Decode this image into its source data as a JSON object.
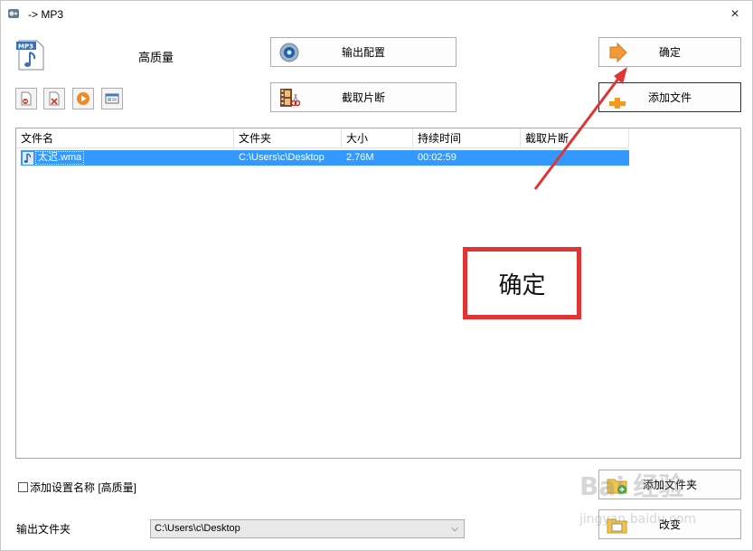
{
  "window": {
    "title": "-> MP3",
    "close_glyph": "×"
  },
  "header": {
    "quality_label": "高质量"
  },
  "toolbar": {
    "icons": [
      "remove-file-icon",
      "clear-list-icon",
      "play-icon",
      "media-info-icon"
    ]
  },
  "buttons": {
    "output_config": "输出配置",
    "clip": "截取片断",
    "ok": "确定",
    "add_file": "添加文件",
    "add_folder": "添加文件夹",
    "change": "改变"
  },
  "table": {
    "columns": [
      "文件名",
      "文件夹",
      "大小",
      "持续时间",
      "截取片断"
    ],
    "rows": [
      {
        "name": "太迟.wma",
        "folder": "C:\\Users\\c\\Desktop",
        "size": "2.76M",
        "duration": "00:02:59",
        "clip": ""
      }
    ]
  },
  "annotation": {
    "text": "确定",
    "color": "#e03535"
  },
  "bottom": {
    "checkbox_label": "添加设置名称 [高质量]",
    "output_folder_label": "输出文件夹",
    "output_folder_value": "C:\\Users\\c\\Desktop"
  },
  "watermark": {
    "line1": "Bai 经验",
    "line2": "jingyan.baidu.com"
  },
  "colors": {
    "selection": "#3399ff",
    "accent_red": "#e03535"
  }
}
